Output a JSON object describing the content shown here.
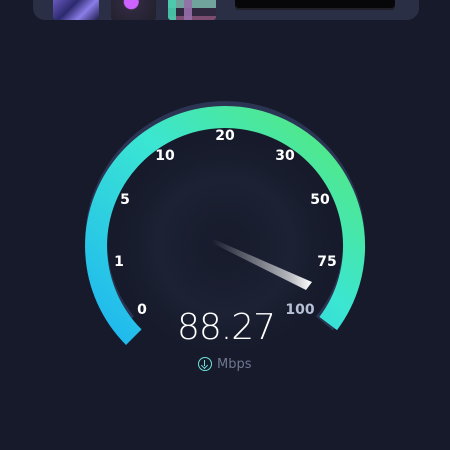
{
  "top": {
    "thumbnails": [
      {
        "name": "thumbnail-purple"
      },
      {
        "name": "thumbnail-neon"
      },
      {
        "name": "thumbnail-pixel"
      }
    ]
  },
  "gauge": {
    "labels": [
      "0",
      "1",
      "5",
      "10",
      "20",
      "30",
      "50",
      "75",
      "100"
    ],
    "value": "88.27",
    "unit": "Mbps",
    "unit_icon": "download-icon",
    "progress_fraction": 0.97,
    "colors": {
      "background": "#161a2b",
      "gauge_start": "#1fb6f0",
      "gauge_mid": "#3be6d2",
      "gauge_end": "#57e874",
      "unfilled": "#2b3553"
    }
  }
}
